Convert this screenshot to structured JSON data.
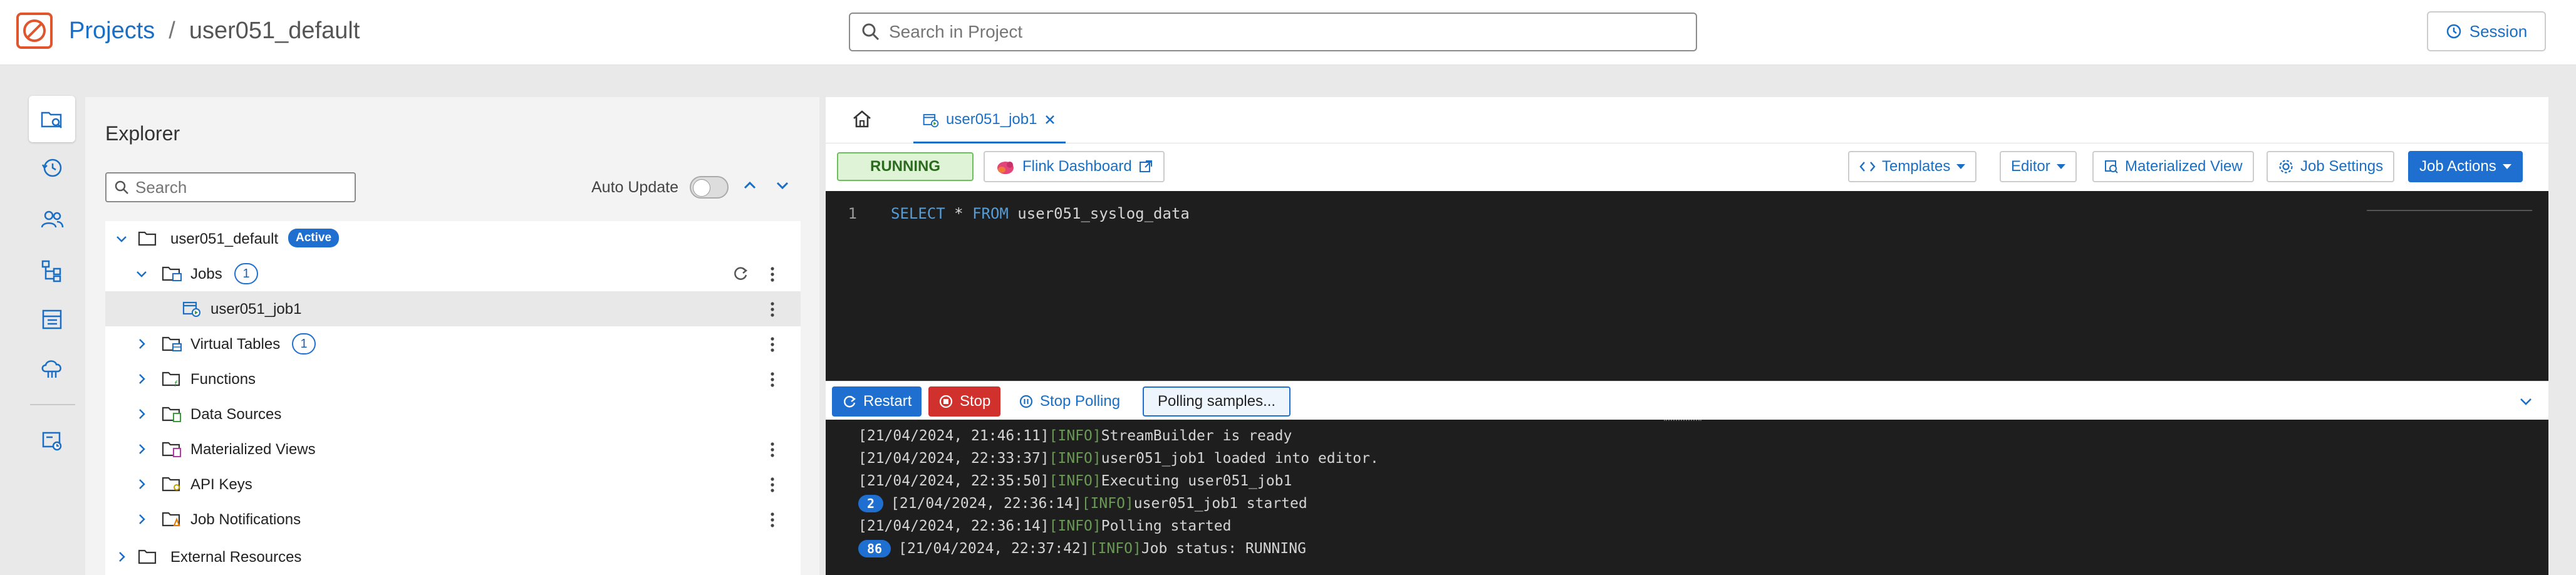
{
  "header": {
    "breadcrumb_root": "Projects",
    "breadcrumb_separator": "/",
    "breadcrumb_current": "user051_default",
    "search_placeholder": "Search in Project",
    "session_label": "Session"
  },
  "rail": {
    "items": [
      "explorer-icon",
      "history-icon",
      "users-icon",
      "tree-icon",
      "catalog-icon",
      "cloud-icon",
      "monitor-icon"
    ]
  },
  "explorer": {
    "title": "Explorer",
    "search_placeholder": "Search",
    "auto_update_label": "Auto Update",
    "auto_update_on": false,
    "tree": {
      "project": {
        "label": "user051_default",
        "badge": "Active"
      },
      "jobs": {
        "label": "Jobs",
        "count": "1"
      },
      "job1": {
        "label": "user051_job1"
      },
      "virtual_tables": {
        "label": "Virtual Tables",
        "count": "1"
      },
      "functions": {
        "label": "Functions"
      },
      "data_sources": {
        "label": "Data Sources"
      },
      "materialized_views": {
        "label": "Materialized Views"
      },
      "api_keys": {
        "label": "API Keys"
      },
      "job_notifications": {
        "label": "Job Notifications"
      },
      "external_resources": {
        "label": "External Resources"
      }
    }
  },
  "editor": {
    "tab_label": "user051_job1",
    "status": "RUNNING",
    "flink_dashboard": "Flink Dashboard",
    "templates": "Templates",
    "editor_menu": "Editor",
    "materialized_view": "Materialized View",
    "job_settings": "Job Settings",
    "job_actions": "Job Actions",
    "code": {
      "line_number": "1",
      "kw1": "SELECT",
      "star": " * ",
      "kw2": "FROM",
      "table": " user051_syslog_data"
    }
  },
  "console": {
    "restart": "Restart",
    "stop": "Stop",
    "stop_polling": "Stop Polling",
    "polling_samples": "Polling samples...",
    "logs": [
      {
        "count": "",
        "time": "[21/04/2024, 21:46:11]",
        "level": "[INFO]",
        "msg": "StreamBuilder is ready"
      },
      {
        "count": "",
        "time": "[21/04/2024, 22:33:37]",
        "level": "[INFO]",
        "msg": "user051_job1 loaded into editor."
      },
      {
        "count": "",
        "time": "[21/04/2024, 22:35:50]",
        "level": "[INFO]",
        "msg": "Executing user051_job1"
      },
      {
        "count": "2",
        "time": "[21/04/2024, 22:36:14]",
        "level": "[INFO]",
        "msg": "user051_job1 started"
      },
      {
        "count": "",
        "time": "[21/04/2024, 22:36:14]",
        "level": "[INFO]",
        "msg": "Polling started"
      },
      {
        "count": "86",
        "time": "[21/04/2024, 22:37:42]",
        "level": "[INFO]",
        "msg": "Job status: RUNNING"
      }
    ]
  },
  "colors": {
    "brand_orange": "#e0552b",
    "link_blue": "#1a6fc4",
    "primary_blue": "#1f6fd0",
    "stop_red": "#d0312d",
    "running_green": "#dff4d7",
    "editor_bg": "#1e1e1e"
  }
}
